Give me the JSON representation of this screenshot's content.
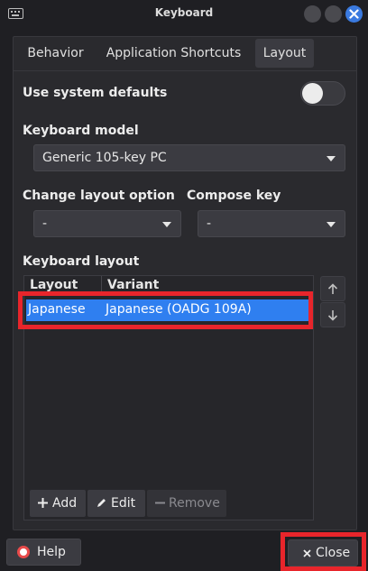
{
  "window": {
    "title": "Keyboard"
  },
  "tabs": [
    {
      "label": "Behavior",
      "active": false
    },
    {
      "label": "Application Shortcuts",
      "active": false
    },
    {
      "label": "Layout",
      "active": true
    }
  ],
  "layout": {
    "use_system_defaults_label": "Use system defaults",
    "use_system_defaults_on": false,
    "keyboard_model_label": "Keyboard model",
    "keyboard_model_value": "Generic 105-key PC",
    "change_layout_option_label": "Change layout option",
    "change_layout_option_value": "-",
    "compose_key_label": "Compose key",
    "compose_key_value": "-",
    "keyboard_layout_label": "Keyboard layout",
    "columns": [
      "Layout",
      "Variant"
    ],
    "rows": [
      {
        "layout": "Japanese",
        "variant": "Japanese (OADG 109A)",
        "selected": true
      }
    ],
    "add_label": "Add",
    "edit_label": "Edit",
    "remove_label": "Remove"
  },
  "footer": {
    "help_label": "Help",
    "close_label": "Close"
  },
  "colors": {
    "accent": "#2f7ff0",
    "highlight": "#e8252b",
    "background": "#2a2a2e"
  },
  "icons": [
    "keyboard-icon",
    "minimize-icon",
    "maximize-icon",
    "close-icon",
    "arrow-up-icon",
    "arrow-down-icon",
    "plus-icon",
    "pencil-icon",
    "minus-icon",
    "help-icon",
    "x-icon"
  ]
}
